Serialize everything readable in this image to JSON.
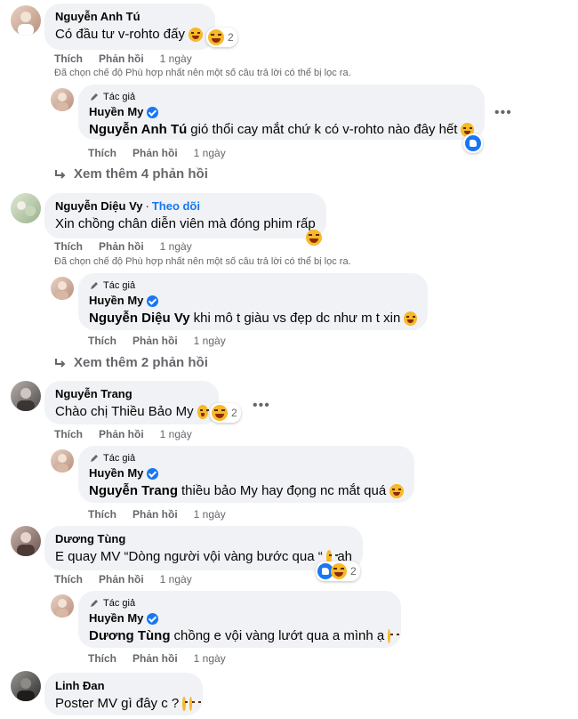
{
  "labels": {
    "like": "Thích",
    "reply": "Phản hồi",
    "author_badge": "Tác giả",
    "follow": "Theo dõi",
    "filter_note": "Đã chọn chế độ Phù hợp nhất nên một số câu trả lời có thể bị lọc ra."
  },
  "threads": [
    {
      "comment": {
        "author": "Nguyễn Anh Tú",
        "text": "Có đầu tư v-rohto đấy",
        "time": "1 ngày",
        "reaction_count": "2"
      },
      "show_note": true,
      "reply": {
        "author": "Huyền My",
        "tag": "Nguyễn Anh Tú",
        "text": "gió thổi cay mắt chứ k có v-rohto nào đây hết",
        "time": "1 ngày"
      },
      "see_more": "Xem thêm 4 phản hồi"
    },
    {
      "comment": {
        "author": "Nguyễn Diệu Vy",
        "text": "Xin chồng chân diễn viên mà đóng phim rấp",
        "time": "1 ngày"
      },
      "show_note": true,
      "reply": {
        "author": "Huyền My",
        "tag": "Nguyễn Diệu Vy",
        "text": "khi mô t giàu vs đẹp dc như m t xin",
        "time": "1 ngày"
      },
      "see_more": "Xem thêm 2 phản hồi"
    },
    {
      "comment": {
        "author": "Nguyễn Trang",
        "text": "Chào chị Thiều Bảo My",
        "time": "1 ngày",
        "reaction_count": "2"
      },
      "reply": {
        "author": "Huyền My",
        "tag": "Nguyễn Trang",
        "text": "thiều bảo My hay đọng nc mắt quá",
        "time": "1 ngày"
      }
    },
    {
      "comment": {
        "author": "Dương Tùng",
        "text": "E quay MV “Dòng người vội vàng bước qua “",
        "text_after": "ah",
        "time": "1 ngày",
        "reaction_count": "2"
      },
      "reply": {
        "author": "Huyền My",
        "tag": "Dương Tùng",
        "text": "chồng e vội vàng lướt qua a mình ạ",
        "time": "1 ngày"
      }
    },
    {
      "comment": {
        "author": "Linh Đan",
        "text": "Poster MV gì đây c ?"
      }
    }
  ],
  "icons": {
    "author_badge": "pen-icon",
    "see_more": "reply-arrow-icon",
    "more": "more-options-icon",
    "reactions": [
      "haha-reaction-icon",
      "like-reaction-icon"
    ]
  },
  "colors": {
    "bubble": "#f0f2f5",
    "accent": "#1877f2",
    "secondary_text": "#65676b",
    "primary_text": "#050505"
  }
}
